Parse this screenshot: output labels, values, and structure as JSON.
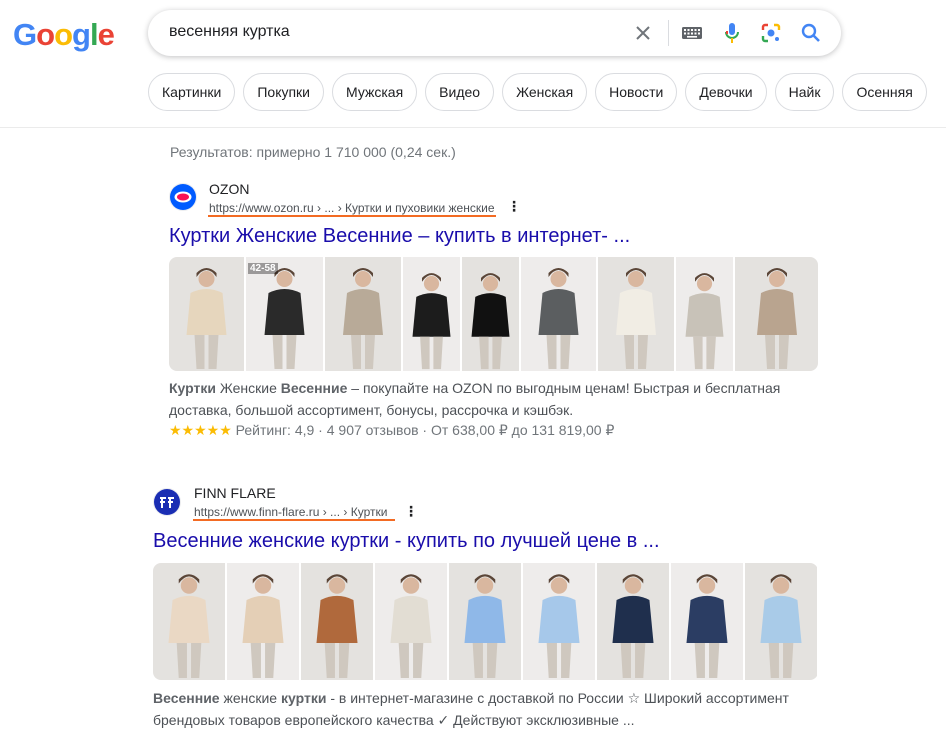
{
  "logo": {
    "letters": [
      "G",
      "o",
      "o",
      "g",
      "l",
      "e"
    ],
    "colors": [
      "#4285f4",
      "#ea4335",
      "#fbbc05",
      "#4285f4",
      "#34a853",
      "#ea4335"
    ]
  },
  "search": {
    "query": "весенняя куртка",
    "icons": [
      "clear-icon",
      "keyboard-icon",
      "mic-icon",
      "lens-icon",
      "search-icon"
    ]
  },
  "chips": [
    "Картинки",
    "Покупки",
    "Мужская",
    "Видео",
    "Женская",
    "Новости",
    "Девочки",
    "Найк",
    "Осенняя"
  ],
  "stats": "Результатов: примерно 1 710 000 (0,24 сек.)",
  "results": [
    {
      "site_name": "OZON",
      "url": "https://www.ozon.ru › ... › Куртки и пуховики женские",
      "title": "Куртки Женские Весенние – купить в интернет- ...",
      "snippet_parts": [
        {
          "b": true,
          "t": "Куртки"
        },
        {
          "b": false,
          "t": " Женские "
        },
        {
          "b": true,
          "t": "Весенние"
        },
        {
          "b": false,
          "t": " – покупайте на OZON по выгодным ценам! Быстрая и бесплатная доставка, большой ассортимент, бонусы, рассрочка и кэшбэк."
        }
      ],
      "rating": {
        "stars": "★★★★★",
        "text": "Рейтинг: 4,9 · 4 907 отзывов · От 638,00 ₽ до 131 819,00 ₽",
        "value": 4.9
      },
      "thumbnail_badge": "42-58",
      "thumbnail_colors": [
        "#e6d6bd",
        "#2a2a2a",
        "#b8aa98",
        "#1c1c1c",
        "#111111",
        "#5b5e60",
        "#f1ede4",
        "#c8c2b8",
        "#b9a48f"
      ]
    },
    {
      "site_name": "FINN FLARE",
      "url": "https://www.finn-flare.ru › ... › Куртки",
      "title": "Весенние женские куртки - купить по лучшей цене в ...",
      "snippet_parts": [
        {
          "b": true,
          "t": "Весенние"
        },
        {
          "b": false,
          "t": " женские "
        },
        {
          "b": true,
          "t": "куртки"
        },
        {
          "b": false,
          "t": " - в интернет-магазине с доставкой по России ☆ Широкий ассортимент брендовых товаров европейского качества ✓ Действуют эксклюзивные ..."
        }
      ],
      "thumbnail_colors": [
        "#ead8c4",
        "#e4cfb6",
        "#b0693c",
        "#e2ddd3",
        "#8fb8e8",
        "#a6c8ea",
        "#1f2f4d",
        "#2b3d63",
        "#a9cbe8"
      ]
    }
  ]
}
